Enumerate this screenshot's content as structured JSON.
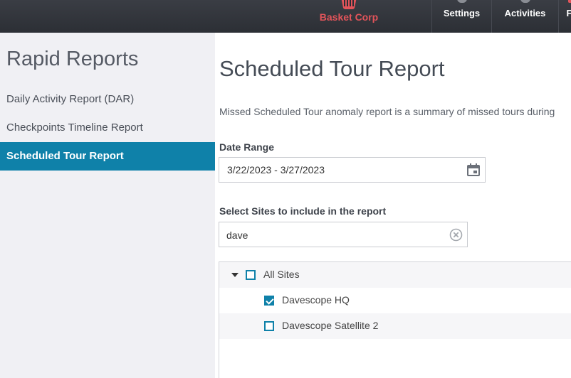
{
  "header": {
    "brand_name": "Basket Corp",
    "brand_icon": "basket-icon",
    "nav": [
      {
        "label": "Settings",
        "icon": "gear-icon"
      },
      {
        "label": "Activities",
        "icon": "activity-icon"
      },
      {
        "label": "F",
        "icon": "flag-icon"
      }
    ]
  },
  "sidebar": {
    "title": "Rapid Reports",
    "items": [
      {
        "label": "Daily Activity Report (DAR)",
        "active": false
      },
      {
        "label": "Checkpoints Timeline Report",
        "active": false
      },
      {
        "label": "Scheduled Tour Report",
        "active": true
      }
    ]
  },
  "main": {
    "title": "Scheduled Tour Report",
    "description": "Missed Scheduled Tour anomaly report is a summary of missed tours during",
    "date_range": {
      "label": "Date Range",
      "value": "3/22/2023 - 3/27/2023"
    },
    "sites": {
      "label": "Select Sites to include in the report",
      "search_value": "dave",
      "tree": [
        {
          "label": "All Sites",
          "checked": false,
          "expanded": true
        },
        {
          "label": "Davescope HQ",
          "checked": true
        },
        {
          "label": "Davescope Satellite 2",
          "checked": false
        }
      ]
    }
  },
  "colors": {
    "accent": "#0f81a9",
    "brand": "#e2545a",
    "topbar": "#2c2f35",
    "sidebar_bg": "#f0f0f4"
  }
}
